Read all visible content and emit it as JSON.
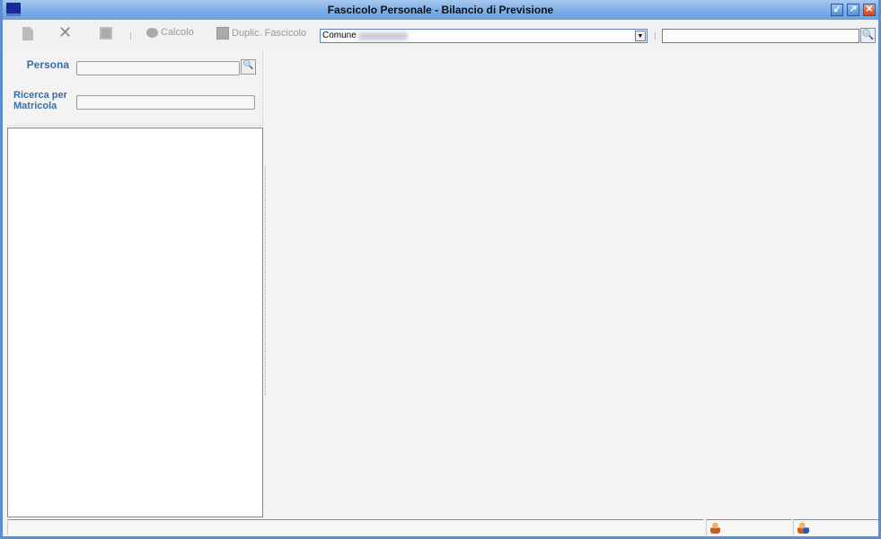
{
  "window": {
    "title": "Fascicolo Personale - Bilancio di Previsione"
  },
  "toolbar": {
    "calcolo_label": "Calcolo",
    "duplica_label": "Duplic. Fascicolo",
    "comune_value": "Comune",
    "search_value": ""
  },
  "form": {
    "persona_label": "Persona",
    "persona_value": "",
    "matricola_label_1": "Ricerca per",
    "matricola_label_2": "Matricola",
    "matricola_value": ""
  },
  "icons": [
    "app-logo-icon",
    "new-document-icon",
    "delete-icon",
    "save-icon",
    "calc-icon",
    "duplicate-icon",
    "dropdown-arrow-icon",
    "search-icon",
    "user-icon",
    "user-info-icon"
  ]
}
